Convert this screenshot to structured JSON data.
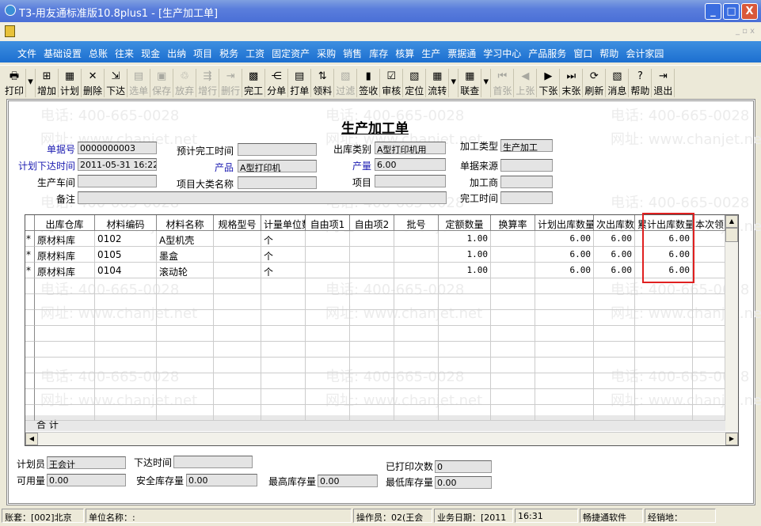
{
  "window": {
    "title": "T3-用友通标准版10.8plus1 - [生产加工单]",
    "min": "_",
    "max": "□",
    "close": "X"
  },
  "mdi_controls": "_ ▫ x",
  "menu": [
    "文件",
    "基础设置",
    "总账",
    "往来",
    "现金",
    "出纳",
    "项目",
    "税务",
    "工资",
    "固定资产",
    "采购",
    "销售",
    "库存",
    "核算",
    "生产",
    "票据通",
    "学习中心",
    "产品服务",
    "窗口",
    "帮助",
    "会计家园"
  ],
  "toolbar": [
    {
      "label": "打印",
      "icon": "printer-icon",
      "glyph": "🖶",
      "enabled": true
    },
    {
      "label": "",
      "icon": "dropdown-icon",
      "glyph": "▾",
      "enabled": true,
      "drop": true
    },
    {
      "label": "增加",
      "icon": "add-icon",
      "glyph": "⊞",
      "enabled": true
    },
    {
      "label": "计划",
      "icon": "plan-icon",
      "glyph": "▦",
      "enabled": true
    },
    {
      "label": "删除",
      "icon": "delete-icon",
      "glyph": "✕",
      "enabled": true
    },
    {
      "label": "下达",
      "icon": "issue-icon",
      "glyph": "⇲",
      "enabled": true
    },
    {
      "label": "选单",
      "icon": "select-icon",
      "glyph": "▤",
      "enabled": false
    },
    {
      "label": "保存",
      "icon": "save-icon",
      "glyph": "▣",
      "enabled": false
    },
    {
      "label": "放弃",
      "icon": "discard-icon",
      "glyph": "♲",
      "enabled": false
    },
    {
      "label": "增行",
      "icon": "add-row-icon",
      "glyph": "⇶",
      "enabled": false
    },
    {
      "label": "删行",
      "icon": "delete-row-icon",
      "glyph": "⇥",
      "enabled": false
    },
    {
      "label": "完工",
      "icon": "complete-icon",
      "glyph": "▩",
      "enabled": true
    },
    {
      "label": "分单",
      "icon": "split-icon",
      "glyph": "⋲",
      "enabled": true
    },
    {
      "label": "打单",
      "icon": "print-doc-icon",
      "glyph": "▤",
      "enabled": true
    },
    {
      "label": "领料",
      "icon": "sort-icon",
      "glyph": "⇅",
      "enabled": true
    },
    {
      "label": "过滤",
      "icon": "filter-icon",
      "glyph": "▧",
      "enabled": false
    },
    {
      "label": "签收",
      "icon": "sign-icon",
      "glyph": "▮",
      "enabled": true
    },
    {
      "label": "审核",
      "icon": "audit-icon",
      "glyph": "☑",
      "enabled": true
    },
    {
      "label": "定位",
      "icon": "locate-icon",
      "glyph": "▧",
      "enabled": true
    },
    {
      "label": "流转",
      "icon": "flow-icon",
      "glyph": "▦",
      "enabled": true
    },
    {
      "label": "",
      "icon": "dropdown-icon",
      "glyph": "▾",
      "enabled": true,
      "drop": true
    },
    {
      "label": "联查",
      "icon": "query-icon",
      "glyph": "▦",
      "enabled": true
    },
    {
      "label": "",
      "icon": "dropdown-icon",
      "glyph": "▾",
      "enabled": true,
      "drop": true
    },
    {
      "label": "首张",
      "icon": "first-icon",
      "glyph": "⏮",
      "enabled": false
    },
    {
      "label": "上张",
      "icon": "prev-icon",
      "glyph": "◀",
      "enabled": false
    },
    {
      "label": "下张",
      "icon": "next-icon",
      "glyph": "▶",
      "enabled": true
    },
    {
      "label": "末张",
      "icon": "last-icon",
      "glyph": "⏭",
      "enabled": true
    },
    {
      "label": "刷新",
      "icon": "refresh-icon",
      "glyph": "⟳",
      "enabled": true
    },
    {
      "label": "消息",
      "icon": "message-icon",
      "glyph": "▧",
      "enabled": true
    },
    {
      "label": "帮助",
      "icon": "help-icon",
      "glyph": "?",
      "enabled": true
    },
    {
      "label": "退出",
      "icon": "exit-icon",
      "glyph": "⇥",
      "enabled": true
    }
  ],
  "watermark": {
    "phone": "电话: 400-665-0028",
    "site": "网址: www.chanjet.net"
  },
  "form": {
    "title": "生产加工单",
    "doc_no": {
      "label": "单据号",
      "value": "0000000003"
    },
    "plan_time": {
      "label": "计划下达时间",
      "value": "2011-05-31 16:22"
    },
    "workshop": {
      "label": "生产车间",
      "value": ""
    },
    "remark": {
      "label": "备注",
      "value": ""
    },
    "expected_finish": {
      "label": "预计完工时间",
      "value": ""
    },
    "product": {
      "label": "产品",
      "value": "A型打印机"
    },
    "project_class": {
      "label": "项目大类名称",
      "value": ""
    },
    "out_type": {
      "label": "出库类别",
      "value": "A型打印机用"
    },
    "output": {
      "label": "产量",
      "value": "6.00"
    },
    "project": {
      "label": "项目",
      "value": ""
    },
    "process_type": {
      "label": "加工类型",
      "value": "生产加工"
    },
    "source": {
      "label": "单据来源",
      "value": ""
    },
    "processor": {
      "label": "加工商",
      "value": ""
    },
    "finish_time": {
      "label": "完工时间",
      "value": ""
    }
  },
  "table": {
    "columns": [
      "出库仓库",
      "材料编码",
      "材料名称",
      "规格型号",
      "计量单位数",
      "自由项1",
      "自由项2",
      "批号",
      "定额数量",
      "换算率",
      "计划出库数量",
      "次出库数",
      "累计出库数量",
      "本次领"
    ],
    "rows": [
      [
        "*",
        "原材料库",
        "0102",
        "A型机壳",
        "",
        "个",
        "",
        "",
        "",
        "1.00",
        "",
        "6.00",
        "6.00",
        "6.00",
        ""
      ],
      [
        "*",
        "原材料库",
        "0105",
        "墨盒",
        "",
        "个",
        "",
        "",
        "",
        "1.00",
        "",
        "6.00",
        "6.00",
        "6.00",
        ""
      ],
      [
        "*",
        "原材料库",
        "0104",
        "滚动轮",
        "",
        "个",
        "",
        "",
        "",
        "1.00",
        "",
        "6.00",
        "6.00",
        "6.00",
        ""
      ]
    ],
    "total_label": "合 计"
  },
  "footer": {
    "planner": {
      "label": "计划员",
      "value": "王会计"
    },
    "issue_time": {
      "label": "下达时间",
      "value": ""
    },
    "printed": {
      "label": "已打印次数",
      "value": "0"
    },
    "available": {
      "label": "可用量",
      "value": "0.00"
    },
    "safety": {
      "label": "安全库存量",
      "value": "0.00"
    },
    "max_stock": {
      "label": "最高库存量",
      "value": "0.00"
    },
    "min_stock": {
      "label": "最低库存量",
      "value": "0.00"
    }
  },
  "status": [
    "账套：[002]北京",
    "单位名称：:",
    "操作员：02(王会",
    "业务日期：[2011",
    "16:31",
    "畅捷通软件",
    "经销地："
  ]
}
